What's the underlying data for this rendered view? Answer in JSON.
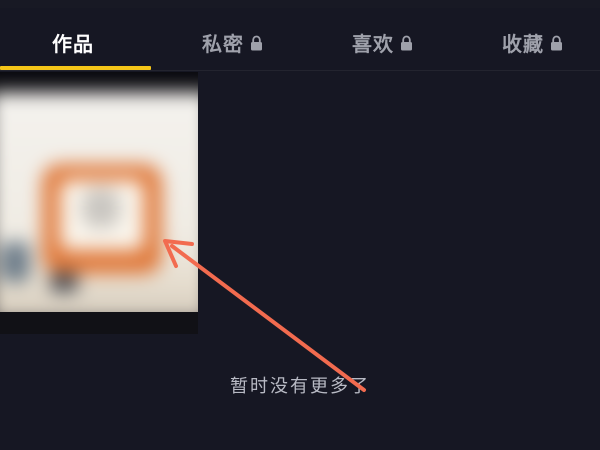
{
  "tabs": [
    {
      "label": "作品",
      "active": true,
      "locked": false
    },
    {
      "label": "私密",
      "active": false,
      "locked": true
    },
    {
      "label": "喜欢",
      "active": false,
      "locked": true
    },
    {
      "label": "收藏",
      "active": false,
      "locked": true
    }
  ],
  "indicator_color": "#f5c518",
  "empty_message": "暂时没有更多了",
  "annotation_color": "#f26b4f",
  "colors": {
    "background": "#161723",
    "active_tab_text": "#ffffff",
    "inactive_tab_text": "#9fa1ab"
  }
}
